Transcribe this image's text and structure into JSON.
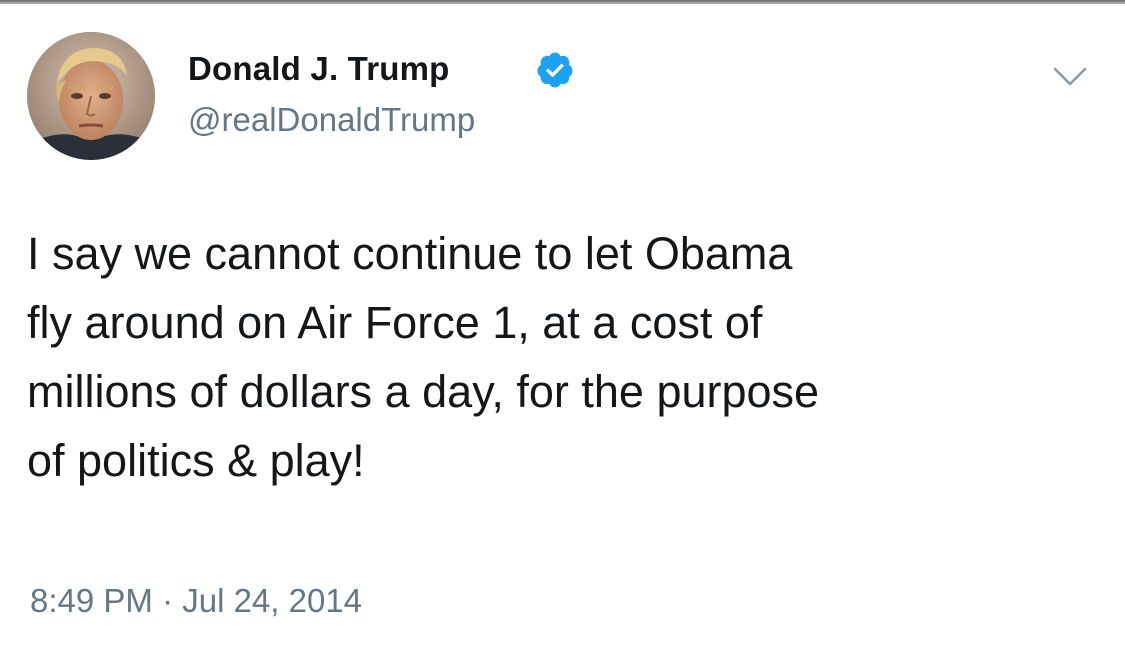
{
  "tweet": {
    "author": {
      "display_name": "Donald J. Trump",
      "handle": "@realDonaldTrump",
      "verified": true,
      "avatar": "profile-photo"
    },
    "text": "I say we cannot continue to let Obama\nfly around on Air Force 1, at a cost of\nmillions of dollars a day, for the purpose\nof politics & play!",
    "timestamp": "8:49 PM · Jul 24, 2014",
    "menu_icon": "chevron-down-icon"
  },
  "colors": {
    "text_primary": "#14171a",
    "text_secondary": "#657786",
    "verified_blue": "#1da1f2",
    "background": "#ffffff"
  }
}
